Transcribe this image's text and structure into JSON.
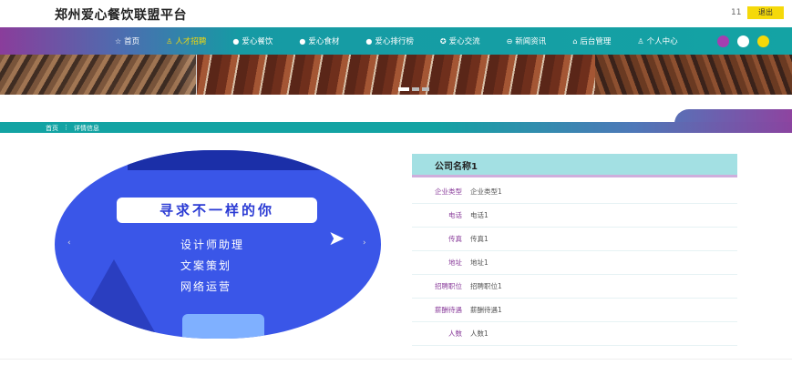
{
  "header": {
    "site_title": "郑州爱心餐饮联盟平台",
    "user_label": "11",
    "logout_label": "退出"
  },
  "nav": {
    "items": [
      {
        "icon": "☆",
        "label": "首页"
      },
      {
        "icon": "♙",
        "label": "人才招聘"
      },
      {
        "icon": "●",
        "label": "爱心餐饮"
      },
      {
        "icon": "●",
        "label": "爱心食材"
      },
      {
        "icon": "●",
        "label": "爱心排行榜"
      },
      {
        "icon": "✪",
        "label": "爱心交流"
      },
      {
        "icon": "⊖",
        "label": "新闻资讯"
      },
      {
        "icon": "⌂",
        "label": "后台管理"
      },
      {
        "icon": "♙",
        "label": "个人中心"
      }
    ],
    "active_index": 1,
    "theme_colors": [
      "#a43fb0",
      "#ffffff",
      "#f5d90a"
    ]
  },
  "breadcrumb": {
    "home": "首页",
    "separator": "⋮",
    "current": "详情信息"
  },
  "poster": {
    "tagline": "寻求不一样的你",
    "lines": [
      "设计师助理",
      "文案策划",
      "网络运营"
    ],
    "prev_icon": "‹",
    "next_icon": "›"
  },
  "detail": {
    "company_name": "公司名称1",
    "fields": [
      {
        "label": "企业类型",
        "value": "企业类型1"
      },
      {
        "label": "电话",
        "value": "电话1"
      },
      {
        "label": "传真",
        "value": "传真1"
      },
      {
        "label": "地址",
        "value": "地址1"
      },
      {
        "label": "招聘职位",
        "value": "招聘职位1"
      },
      {
        "label": "薪酬待遇",
        "value": "薪酬待遇1"
      },
      {
        "label": "人数",
        "value": "人数1"
      }
    ]
  }
}
